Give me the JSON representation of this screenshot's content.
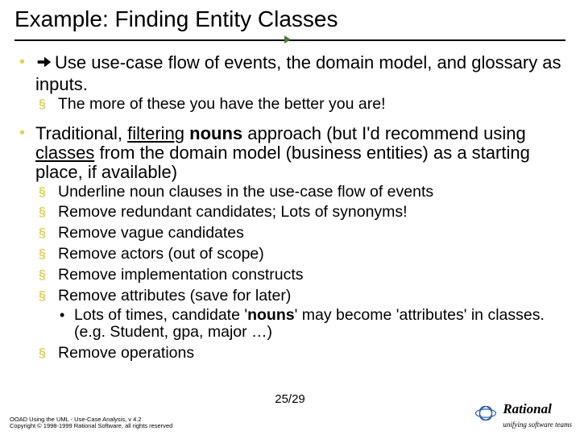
{
  "title": "Example: Finding Entity Classes",
  "bullets": {
    "b1_pre": "Use use-case flow of events, the domain model, and glossary as inputs.",
    "b1_sub1": "The more of these you have the better you are!",
    "b2_p1": "Traditional, ",
    "b2_u1": "filtering",
    "b2_p2": " ",
    "b2_bold1": "nouns",
    "b2_p3": " approach (but I'd recommend using ",
    "b2_u2": "classes",
    "b2_p4": " from the domain model (business entities) as a starting place, if available)",
    "s1": "Underline noun clauses in the use-case flow of events",
    "s2": "Remove redundant candidates;  Lots of synonyms!",
    "s3": "Remove vague candidates",
    "s4": "Remove actors (out of scope)",
    "s5": "Remove implementation constructs",
    "s6": "Remove attributes (save for later)",
    "s6b_p1": "Lots of times, candidate '",
    "s6b_bold1": "nouns",
    "s6b_p2": "' may become 'attributes' in classes. (e.g. Student, gpa, major …)",
    "s7": "Remove operations"
  },
  "footer": {
    "line1": "OOAD Using the UML - Use-Case Analysis, v 4.2",
    "line2": "Copyright © 1998-1999 Rational Software, all rights reserved",
    "page": "25/29",
    "brand": "Rational",
    "tagline": "unifying software teams"
  }
}
